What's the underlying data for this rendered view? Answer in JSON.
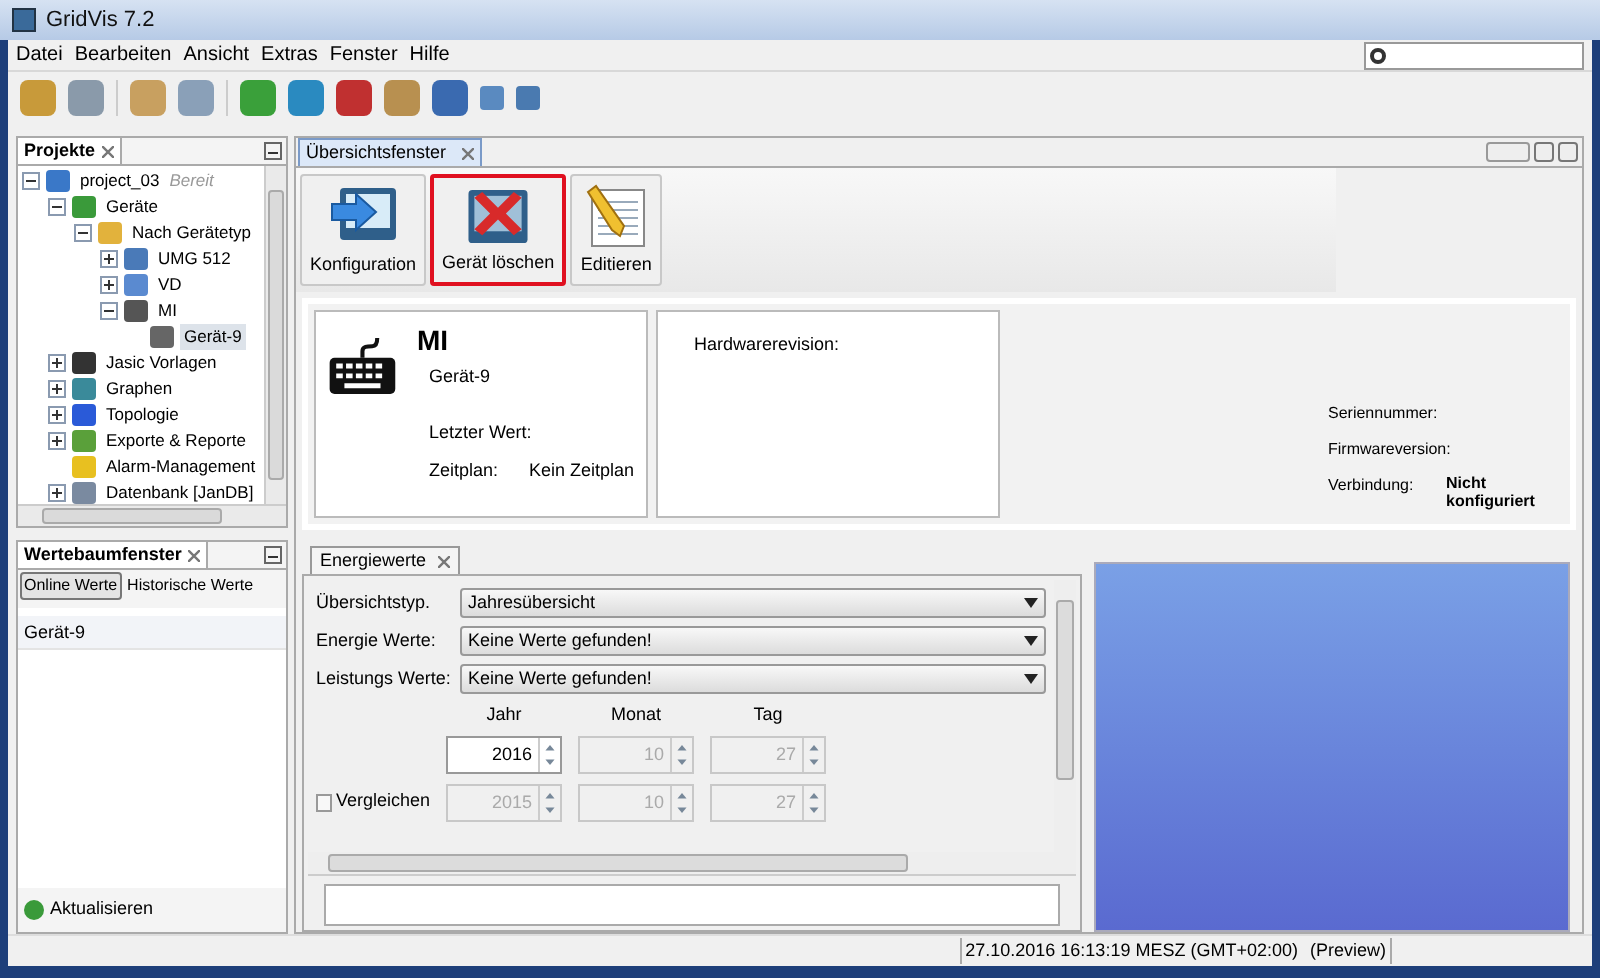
{
  "window": {
    "title": "GridVis 7.2"
  },
  "menu": [
    {
      "label": "Datei"
    },
    {
      "label": "Bearbeiten"
    },
    {
      "label": "Ansicht"
    },
    {
      "label": "Extras"
    },
    {
      "label": "Fenster"
    },
    {
      "label": "Hilfe"
    }
  ],
  "projects_panel": {
    "title": "Projekte",
    "tree": [
      {
        "label": "project_03",
        "status": "Bereit",
        "expanded": true,
        "selected": false,
        "children": [
          {
            "label": "Geräte",
            "expanded": true,
            "selected": false,
            "children": [
              {
                "label": "Nach Gerätetyp",
                "expanded": true,
                "selected": false,
                "children": [
                  {
                    "label": "UMG 512",
                    "expanded": false,
                    "selected": false
                  },
                  {
                    "label": "VD",
                    "expanded": false,
                    "selected": false
                  },
                  {
                    "label": "MI",
                    "expanded": true,
                    "selected": false,
                    "children": [
                      {
                        "label": "Gerät-9",
                        "selected": true
                      }
                    ]
                  }
                ]
              }
            ]
          },
          {
            "label": "Jasic Vorlagen",
            "expanded": false,
            "selected": false
          },
          {
            "label": "Graphen",
            "expanded": false,
            "selected": false
          },
          {
            "label": "Topologie",
            "expanded": false,
            "selected": false
          },
          {
            "label": "Exporte & Reporte",
            "expanded": false,
            "selected": false
          },
          {
            "label": "Alarm-Management",
            "selected": false
          },
          {
            "label": "Datenbank [JanDB]",
            "expanded": false,
            "selected": false
          }
        ]
      }
    ]
  },
  "values_panel": {
    "title": "Wertebaumfenster",
    "tabs": [
      {
        "label": "Online Werte",
        "selected": true
      },
      {
        "label": "Historische Werte",
        "selected": false
      }
    ],
    "items": [
      "Gerät-9"
    ],
    "refresh_button": "Aktualisieren"
  },
  "editor_tab": {
    "label": "Übersichtsfenster",
    "selected": true
  },
  "actions": [
    {
      "label": "Konfiguration",
      "highlighted": false
    },
    {
      "label": "Gerät löschen",
      "highlighted": true
    },
    {
      "label": "Editieren",
      "highlighted": false
    }
  ],
  "device_card": {
    "name": "MI",
    "device": "Gerät-9",
    "fields": [
      {
        "label": "Letzter Wert:"
      },
      {
        "label": "Zeitplan:",
        "value": "Kein Zeitplan"
      }
    ]
  },
  "hardware_card": {
    "label": "Hardwarerevision:"
  },
  "device_info": [
    {
      "label": "Seriennummer:"
    },
    {
      "label": "Firmwareversion:"
    },
    {
      "label": "Verbindung:",
      "value": "Nicht konfiguriert"
    }
  ],
  "energy_panel": {
    "tab": "Energiewerte",
    "selects": [
      {
        "label": "Übersichtstyp.",
        "value": "Jahresübersicht"
      },
      {
        "label": "Energie Werte:",
        "value": "Keine Werte gefunden!"
      },
      {
        "label": "Leistungs Werte:",
        "value": "Keine Werte gefunden!"
      }
    ],
    "date_headers": [
      "Jahr",
      "Monat",
      "Tag"
    ],
    "date": [
      {
        "value": "2016",
        "disabled": false
      },
      {
        "value": "10",
        "disabled": true
      },
      {
        "value": "27",
        "disabled": true
      }
    ],
    "compare": {
      "label": "Vergleichen",
      "checked": false
    },
    "compare_date": [
      {
        "value": "2015",
        "disabled": true
      },
      {
        "value": "10",
        "disabled": true
      },
      {
        "value": "27",
        "disabled": true
      }
    ]
  },
  "status_bar": {
    "datetime": "27.10.2016 16:13:19 MESZ (GMT+02:00)",
    "mode": "(Preview)"
  }
}
